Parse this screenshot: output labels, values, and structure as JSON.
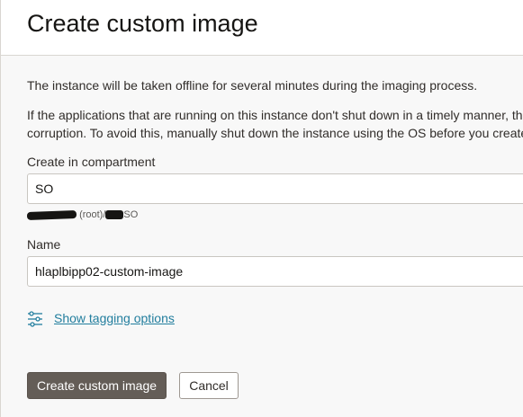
{
  "dialog": {
    "title": "Create custom image",
    "description_1": "The instance will be taken offline for several minutes during the imaging process.",
    "description_2_line1": "If the applications that are running on this instance don't shut down in a timely manner, the",
    "description_2_line2": "corruption. To avoid this, manually shut down the instance using the OS before you create"
  },
  "form": {
    "compartment": {
      "label": "Create in compartment",
      "value": "SO",
      "path_mid": "(root)/",
      "path_end": "SO"
    },
    "name": {
      "label": "Name",
      "value": "hlaplbipp02-custom-image"
    },
    "tagging": {
      "link_label": "Show tagging options",
      "icon": "sliders-icon"
    }
  },
  "actions": {
    "create_label": "Create custom image",
    "cancel_label": "Cancel"
  },
  "colors": {
    "primary_button": "#645d57",
    "link": "#227e9e",
    "background": "#f8f8f8"
  }
}
